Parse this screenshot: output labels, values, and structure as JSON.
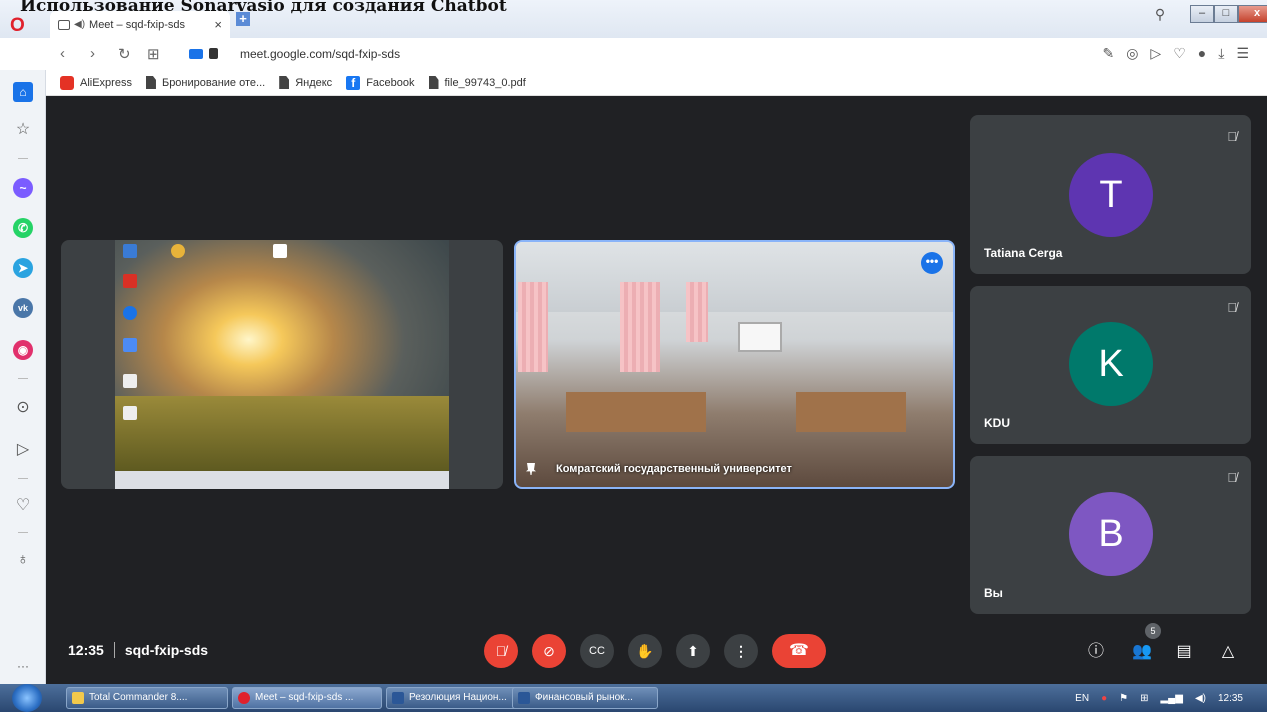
{
  "overlay_text": "Использование Sonarvasio для создания Chatbot",
  "browser": {
    "tab_title": "Meet – sqd-fxip-sds",
    "url": "meet.google.com/sqd-fxip-sds",
    "close_tab_symbol": "×",
    "new_tab_symbol": "+"
  },
  "bookmarks": [
    {
      "label": "AliExpress",
      "icon": "aliexpress-icon"
    },
    {
      "label": "Бронирование оте...",
      "icon": "document-icon"
    },
    {
      "label": "Яндекс",
      "icon": "document-icon"
    },
    {
      "label": "Facebook",
      "icon": "facebook-icon"
    },
    {
      "label": "file_99743_0.pdf",
      "icon": "document-icon"
    }
  ],
  "meet": {
    "time": "12:35",
    "meeting_code": "sqd-fxip-sds",
    "camera_participant": "Комратский государственный университет",
    "participants": [
      {
        "initial": "T",
        "name": "Tatiana Cerga",
        "color": "#5e35b1"
      },
      {
        "initial": "K",
        "name": "KDU",
        "color": "#00796b"
      },
      {
        "initial": "В",
        "name": "Вы",
        "color": "#7e57c2"
      }
    ],
    "participants_count": "5",
    "more_symbol": "•••"
  },
  "taskbar": {
    "items": [
      {
        "label": "Total Commander 8....",
        "color": "#f2c94c"
      },
      {
        "label": "Meet – sqd-fxip-sds ...",
        "color": "#e0212c"
      },
      {
        "label": "Резолюция Национ...",
        "color": "#2b5797"
      },
      {
        "label": "Финансовый рынок...",
        "color": "#2b5797"
      }
    ],
    "lang": "EN",
    "clock": "12:35"
  },
  "colors": {
    "accent": "#1a73e8",
    "danger": "#ea4335",
    "meet_bg": "#202124",
    "tile_bg": "#3c4043"
  }
}
